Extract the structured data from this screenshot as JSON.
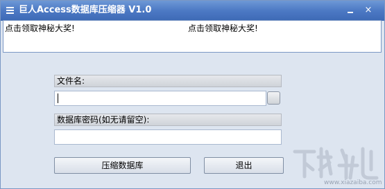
{
  "window": {
    "title": "巨人Access数据库压缩器 V1.0"
  },
  "titlebar": {
    "minimize_glyph": "",
    "close_glyph": "×"
  },
  "ads": {
    "link1": "点击领取神秘大奖!",
    "link2": "点击领取神秘大奖!"
  },
  "form": {
    "filename_label": "文件名:",
    "filename_value": "",
    "password_label": "数据库密码(如无请留空):",
    "password_value": ""
  },
  "buttons": {
    "compress_label": "压缩数据库",
    "exit_label": "退出"
  },
  "watermark": {
    "site": "www.xiazaiba.com"
  },
  "colors": {
    "titlebar": "#4c79c4",
    "window_bg": "#dde5f0",
    "border": "#7a97c4"
  }
}
